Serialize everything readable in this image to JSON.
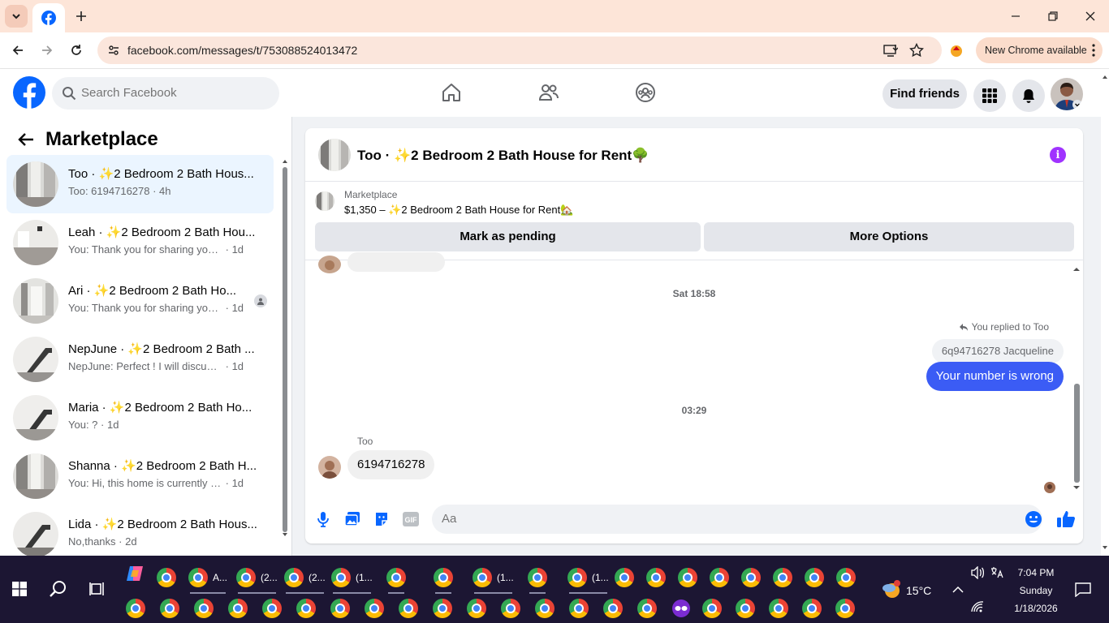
{
  "browser": {
    "url": "facebook.com/messages/t/753088524013472",
    "update_label": "New Chrome available"
  },
  "facebook": {
    "search_placeholder": "Search Facebook",
    "find_friends_label": "Find friends"
  },
  "sidebar": {
    "title": "Marketplace",
    "conversations": [
      {
        "name": "Too · ✨2 Bedroom 2 Bath Hous...",
        "preview": "Too: 6194716278",
        "time": "· 4h",
        "active": true
      },
      {
        "name": "Leah · ✨2 Bedroom 2 Bath Hou...",
        "preview": "You: Thank you for sharing your nu...",
        "time": "· 1d"
      },
      {
        "name": "Ari · ✨2 Bedroom 2 Bath Ho...",
        "preview": "You: Thank you for sharing your ...",
        "time": "· 1d"
      },
      {
        "name": "NepJune · ✨2 Bedroom 2 Bath ...",
        "preview": "NepJune: Perfect ! I will discuss wit...",
        "time": "· 1d"
      },
      {
        "name": "Maria · ✨2 Bedroom 2 Bath Ho...",
        "preview": "You: ?",
        "time": "· 1d"
      },
      {
        "name": "Shanna · ✨2 Bedroom 2 Bath H...",
        "preview": "You: Hi, this home is currently avail...",
        "time": "· 1d"
      },
      {
        "name": "Lida · ✨2 Bedroom 2 Bath Hous...",
        "preview": "No,thanks",
        "time": "· 2d"
      }
    ]
  },
  "chat": {
    "title": "Too · ✨2 Bedroom 2 Bath House for Rent🌳",
    "marketplace_label": "Marketplace",
    "listing": "$1,350 – ✨2 Bedroom 2 Bath House for Rent🏡",
    "mark_pending_label": "Mark as pending",
    "more_options_label": "More Options",
    "timestamp_1": "Sat 18:58",
    "reply_note": "You replied to Too",
    "quoted_text": "6q94716278 Jacqueline",
    "sent_message": "Your number is wrong",
    "timestamp_2": "03:29",
    "sender_name": "Too",
    "received_message": "6194716278",
    "composer_placeholder": "Aa"
  },
  "taskbar": {
    "apps": [
      {
        "label": "A..."
      },
      {
        "label": "(2..."
      },
      {
        "label": "(2..."
      },
      {
        "label": "(1..."
      },
      {
        "label": "(1..."
      },
      {
        "label": "(1..."
      }
    ],
    "weather": "15°C",
    "time": "7:04 PM",
    "day": "Sunday",
    "date": "1/18/2026"
  },
  "colors": {
    "fb_blue": "#0866ff",
    "sent_bubble": "#3b5cf5",
    "info_purple": "#a033ff",
    "taskbar_bg": "#1c1633"
  }
}
